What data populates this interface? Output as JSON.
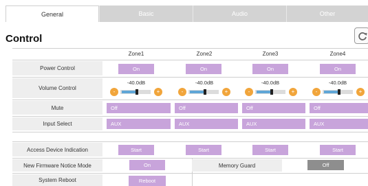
{
  "tabs": [
    {
      "label": "General",
      "active": true
    },
    {
      "label": "Basic",
      "active": false
    },
    {
      "label": "Audio",
      "active": false
    },
    {
      "label": "Other",
      "active": false
    }
  ],
  "title": "Control",
  "icons": {
    "refresh": "refresh-icon"
  },
  "zones": [
    "Zone1",
    "Zone2",
    "Zone3",
    "Zone4"
  ],
  "rows": {
    "power": {
      "label": "Power Control",
      "values": [
        "On",
        "On",
        "On",
        "On"
      ]
    },
    "volume": {
      "label": "Volume Control",
      "values": [
        "-40.0dB",
        "-40.0dB",
        "-40.0dB",
        "-40.0dB"
      ],
      "level": 0.5,
      "minus": "-",
      "plus": "+"
    },
    "mute": {
      "label": "Mute",
      "values": [
        "Off",
        "Off",
        "Off",
        "Off"
      ]
    },
    "input": {
      "label": "Input Select",
      "values": [
        "AUX",
        "AUX",
        "AUX",
        "AUX"
      ]
    },
    "access": {
      "label": "Access Device Indication",
      "values": [
        "Start",
        "Start",
        "Start",
        "Start"
      ]
    },
    "firmware": {
      "label": "New Firmware Notice Mode",
      "value": "On"
    },
    "memory": {
      "label": "Memory Guard",
      "value": "Off"
    },
    "reboot": {
      "label": "System Reboot",
      "value": "Reboot"
    }
  },
  "colors": {
    "accent": "#c8a4db",
    "orange": "#f1a53b",
    "gray_button": "#8e8e8e",
    "label_bg": "#eeeeee"
  }
}
